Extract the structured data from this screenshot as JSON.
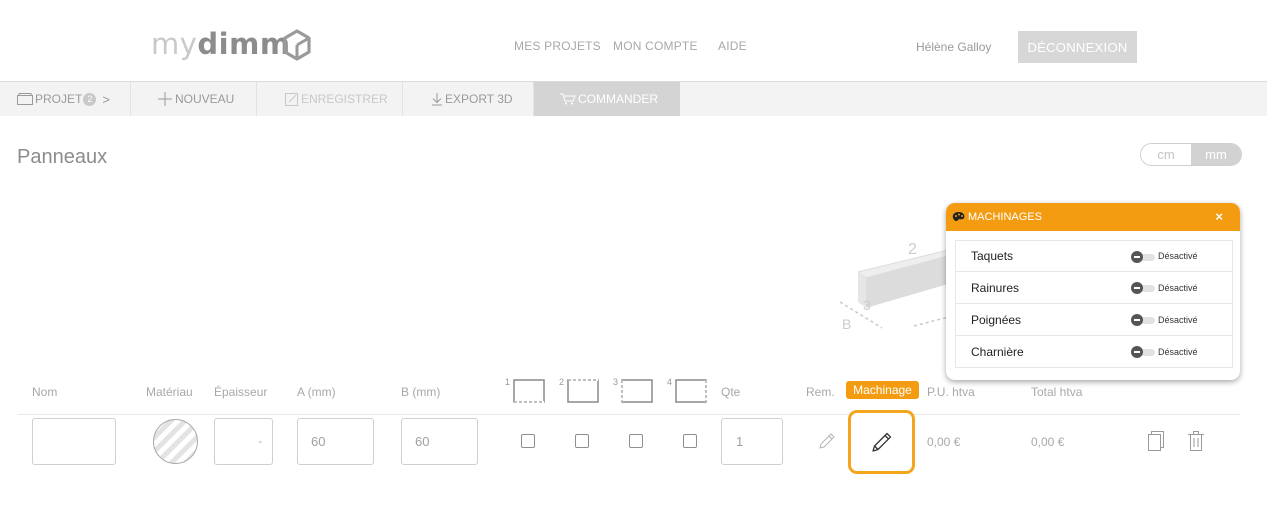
{
  "header": {
    "logo_my": "my",
    "logo_dimm": "dimm",
    "nav": [
      "MES PROJETS",
      "MON COMPTE",
      "AIDE"
    ],
    "user_name": "Hélène Galloy",
    "logout_label": "DÉCONNEXION"
  },
  "toolbar": {
    "project_label": "PROJET",
    "project_count": "2",
    "project_chevron": ">",
    "new_label": "NOUVEAU",
    "save_label": "ENREGISTRER",
    "export_label": "EXPORT 3D",
    "order_label": "COMMANDER"
  },
  "page": {
    "title": "Panneaux",
    "units": [
      "cm",
      "mm"
    ],
    "selected_unit": "mm"
  },
  "drawing": {
    "labels": [
      "2",
      "3",
      "B"
    ]
  },
  "machining_popup": {
    "title": "MACHINAGES",
    "close": "×",
    "icon": "palette-icon",
    "items": [
      {
        "label": "Taquets",
        "state": "Désactivé"
      },
      {
        "label": "Rainures",
        "state": "Désactivé"
      },
      {
        "label": "Poignées",
        "state": "Désactivé"
      },
      {
        "label": "Charnière",
        "state": "Désactivé"
      }
    ]
  },
  "table": {
    "headers": {
      "name": "Nom",
      "material": "Matériau",
      "thickness": "Épaisseur",
      "a": "A (mm)",
      "b": "B (mm)",
      "qty": "Qte",
      "rem": "Rem.",
      "machining": "Machinage",
      "unit_price": "P.U. htva",
      "total": "Total htva"
    },
    "edge_numbers": [
      "1",
      "2",
      "3",
      "4"
    ],
    "row": {
      "name": "",
      "thickness": "-",
      "a": "60",
      "b": "60",
      "qty": "1",
      "unit_price": "0,00 €",
      "total": "0,00 €"
    }
  },
  "colors": {
    "accent": "#f39c12",
    "header_button": "#d7d7d7",
    "toolbar_bg": "#f3f3f3"
  }
}
